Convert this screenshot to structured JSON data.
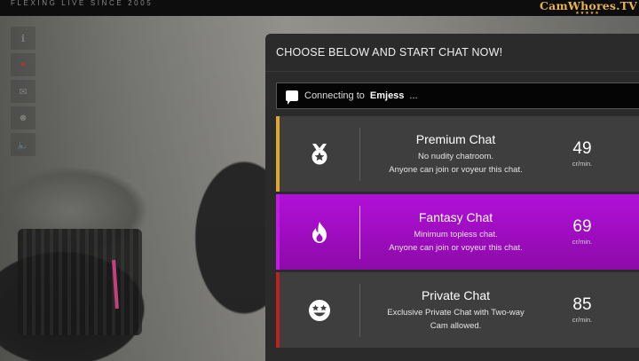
{
  "header": {
    "tagline": "FLEXING LIVE SINCE 2005",
    "logo_text": "CamWhores.TV",
    "logo_stars": "★★★★★"
  },
  "sidebar": {
    "tools": [
      {
        "icon": "info-icon",
        "glyph": "ℹ"
      },
      {
        "icon": "record-icon",
        "glyph": "●"
      },
      {
        "icon": "mail-icon",
        "glyph": "✉"
      },
      {
        "icon": "user-icon",
        "glyph": "☻"
      },
      {
        "icon": "volume-icon",
        "glyph": "🔈"
      }
    ]
  },
  "panel": {
    "title": "CHOOSE BELOW AND START CHAT NOW!",
    "status": {
      "prefix": "Connecting to",
      "name": "Emjess",
      "suffix": "..."
    },
    "options": [
      {
        "title": "Premium Chat",
        "desc1": "No nudity chatroom.",
        "desc2": "Anyone can join or voyeur this chat.",
        "price": "49",
        "unit": "cr/min.",
        "icon": "medal-icon",
        "stripe_color": "#e0a72a"
      },
      {
        "title": "Fantasy Chat",
        "desc1": "Minimum topless chat.",
        "desc2": "Anyone can join or voyeur this chat.",
        "price": "69",
        "unit": "cr/min.",
        "icon": "flame-icon",
        "stripe_color": "#c31ae6"
      },
      {
        "title": "Private Chat",
        "desc1": "Exclusive Private Chat with Two-way",
        "desc2": "Cam allowed.",
        "price": "85",
        "unit": "cr/min.",
        "icon": "star-eyes-smiley-icon",
        "stripe_color": "#c0211f"
      }
    ]
  }
}
